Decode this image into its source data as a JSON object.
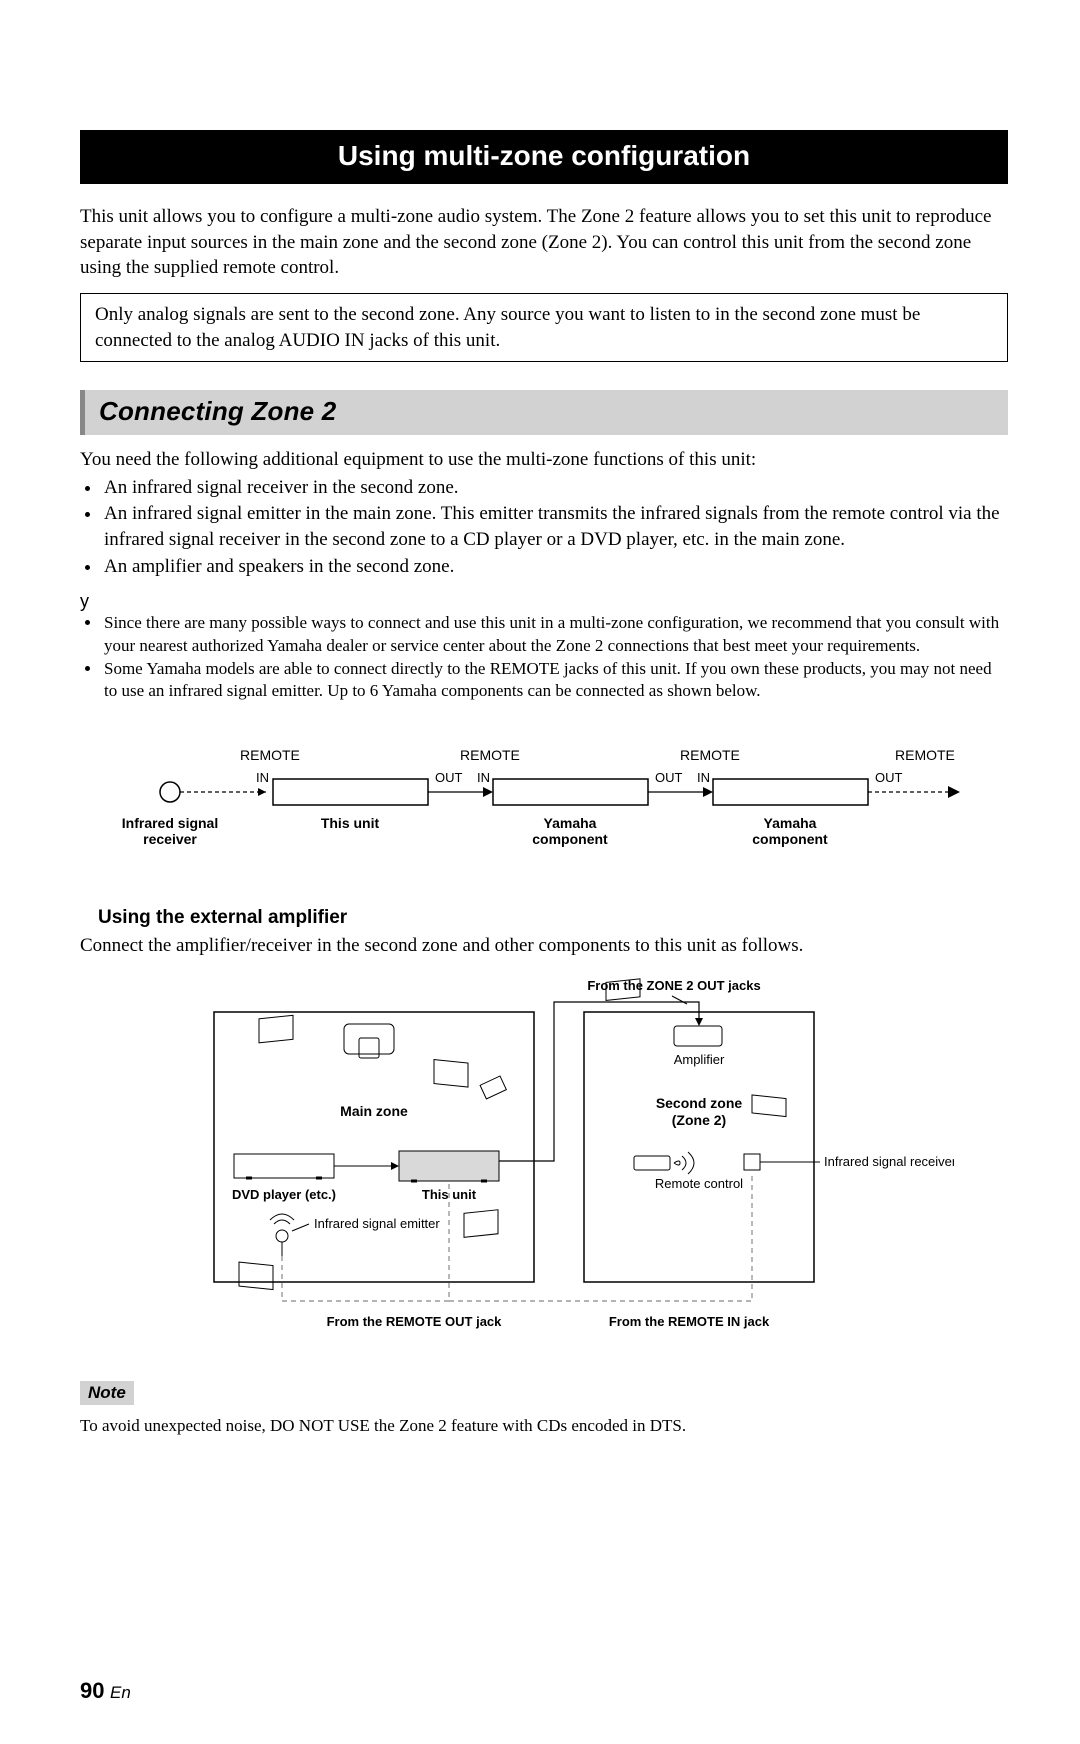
{
  "title": "Using multi-zone configuration",
  "intro": "This unit allows you to configure a multi-zone audio system. The Zone 2 feature allows you to set this unit to reproduce separate input sources in the main zone and the second zone (Zone 2). You can control this unit from the second zone using the supplied remote control.",
  "info_box": "Only analog signals are sent to the second zone. Any source you want to listen to in the second zone must be connected to the analog AUDIO IN jacks of this unit.",
  "section1": {
    "heading": "Connecting Zone 2",
    "lead": "You need the following additional equipment to use the multi-zone functions of this unit:",
    "bullets": [
      "An infrared signal receiver in the second zone.",
      "An infrared signal emitter in the main zone. This emitter transmits the infrared signals from the remote control via the infrared signal receiver in the second zone to a CD player or a DVD player, etc. in the main zone.",
      "An amplifier and speakers in the second zone."
    ],
    "y_mark": "y",
    "notes": [
      "Since there are many possible ways to connect and use this unit in a multi-zone configuration, we recommend that you consult with your nearest authorized Yamaha dealer or service center about the Zone 2 connections that best meet your requirements.",
      "Some Yamaha models are able to connect directly to the REMOTE jacks of this unit. If you own these products, you may not need to use an infrared signal emitter. Up to 6 Yamaha components can be connected as shown below."
    ]
  },
  "diagram1": {
    "remote": "REMOTE",
    "in": "IN",
    "out": "OUT",
    "ir_receiver_l1": "Infrared signal",
    "ir_receiver_l2": "receiver",
    "this_unit": "This unit",
    "yamaha_l1": "Yamaha",
    "yamaha_l2": "component"
  },
  "subsection": {
    "heading": "Using the external amplifier",
    "body": "Connect the amplifier/receiver in the second zone and other components to this unit as follows."
  },
  "diagram2": {
    "from_zone2": "From the ZONE 2 OUT jacks",
    "main_zone": "Main zone",
    "second_zone_l1": "Second zone",
    "second_zone_l2": "(Zone 2)",
    "amplifier": "Amplifier",
    "dvd": "DVD player (etc.)",
    "this_unit": "This unit",
    "ir_emitter": "Infrared signal emitter",
    "ir_receiver": "Infrared signal receiver",
    "remote_control": "Remote control",
    "from_remote_out": "From the REMOTE OUT jack",
    "from_remote_in": "From the REMOTE IN jack"
  },
  "note": {
    "label": "Note",
    "body": "To avoid unexpected noise, DO NOT USE the Zone 2 feature with CDs encoded in DTS."
  },
  "page": {
    "num": "90",
    "lang": "En"
  }
}
